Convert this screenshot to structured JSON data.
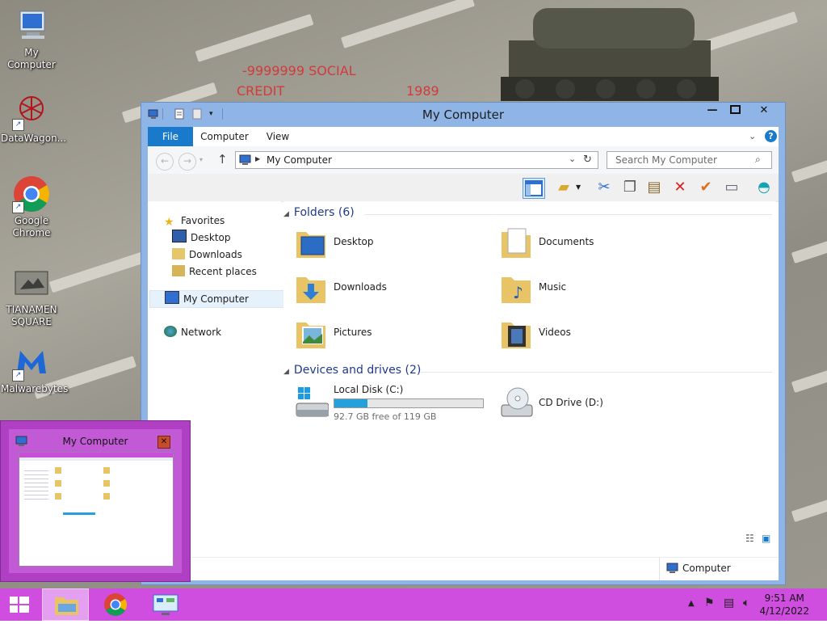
{
  "wallpaper": {
    "caption_line1": "-9999999 SOCIAL",
    "caption_line2": "CREDIT",
    "caption_year": "1989"
  },
  "desktop_icons": [
    {
      "label": "My Computer",
      "icon": "computer-icon"
    },
    {
      "label": "DataWagon...",
      "icon": "datawagon-icon"
    },
    {
      "label": "Google Chrome",
      "icon": "chrome-icon"
    },
    {
      "label": "TIANAMEN SQUARE",
      "icon": "photo-icon"
    },
    {
      "label": "Malwarebytes",
      "icon": "malwarebytes-icon"
    }
  ],
  "window": {
    "title": "My Computer",
    "tabs": {
      "file": "File",
      "computer": "Computer",
      "view": "View"
    },
    "address": "My Computer",
    "search_placeholder": "Search My Computer",
    "nav": {
      "favorites": "Favorites",
      "desktop": "Desktop",
      "downloads": "Downloads",
      "recent": "Recent places",
      "my_computer": "My Computer",
      "network": "Network"
    },
    "folders_header": "Folders (6)",
    "folders": [
      {
        "name": "Desktop"
      },
      {
        "name": "Documents"
      },
      {
        "name": "Downloads"
      },
      {
        "name": "Music"
      },
      {
        "name": "Pictures"
      },
      {
        "name": "Videos"
      }
    ],
    "devices_header": "Devices and drives (2)",
    "drives": {
      "local_name": "Local Disk (C:)",
      "local_free": "92.7 GB free of 119 GB",
      "local_used_fraction": 0.221,
      "cd_name": "CD Drive (D:)"
    },
    "status": "Computer"
  },
  "thumbnail": {
    "title": "My Computer"
  },
  "taskbar": {
    "time": "9:51 AM",
    "date": "4/12/2022"
  },
  "colors": {
    "accent": "#1979ca",
    "taskbar": "#cf4ddf",
    "progress": "#26a0da"
  }
}
